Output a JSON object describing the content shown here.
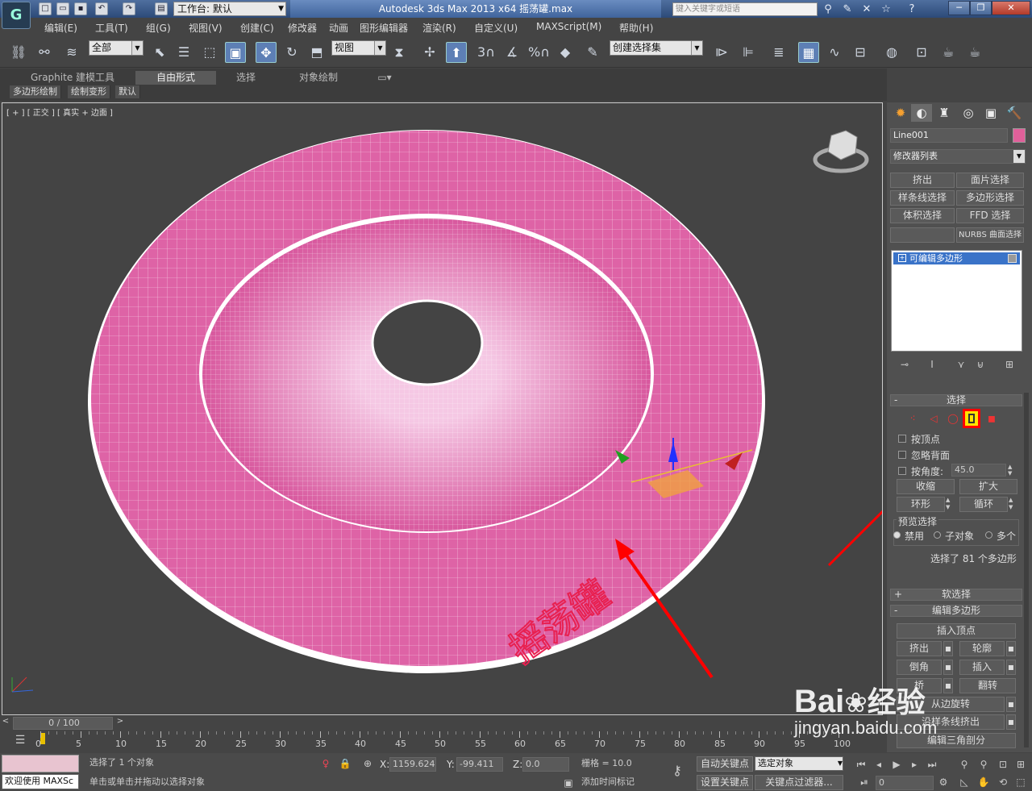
{
  "titlebar": {
    "app_title": "Autodesk 3ds Max  2013 x64      摇荡罐.max",
    "workspace": "工作台: 默认",
    "search_placeholder": "键入关键字或短语"
  },
  "menus": [
    "编辑(E)",
    "工具(T)",
    "组(G)",
    "视图(V)",
    "创建(C)",
    "修改器",
    "动画",
    "图形编辑器",
    "渲染(R)",
    "自定义(U)",
    "MAXScript(M)",
    "帮助(H)"
  ],
  "toolbar": {
    "filter_combo": "全部",
    "ref_coord_combo": "视图",
    "named_selection": "创建选择集",
    "snap_3": "3",
    "snap_pct": "%"
  },
  "ribbon": {
    "tabs": [
      "Graphite 建模工具",
      "自由形式",
      "选择",
      "对象绘制"
    ],
    "subtabs": [
      "多边形绘制",
      "绘制变形",
      "默认"
    ]
  },
  "viewport": {
    "label": "[ + ] [ 正交 ] [ 真实 + 边面 ]",
    "mesh_color": "#e06aa6",
    "text_on_mesh": "摇荡罐"
  },
  "command_panel": {
    "object_name": "Line001",
    "object_color": "#e0609a",
    "modifier_list": "修改器列表",
    "modifier_buttons": [
      "挤出",
      "面片选择",
      "样条线选择",
      "多边形选择",
      "体积选择",
      "FFD 选择",
      "",
      "NURBS 曲面选择"
    ],
    "stack_item": "可编辑多边形",
    "selection_rollout": {
      "title": "选择",
      "by_vertex": "按顶点",
      "ignore_backface": "忽略背面",
      "by_angle": "按角度:",
      "angle_value": "45.0",
      "shrink": "收缩",
      "grow": "扩大",
      "ring": "环形",
      "loop": "循环",
      "preview_label": "预览选择",
      "preview_options": [
        "禁用",
        "子对象",
        "多个"
      ],
      "status": "选择了 81 个多边形"
    },
    "soft_selection": "软选择",
    "edit_poly": {
      "title": "编辑多边形",
      "insert_vertex": "插入顶点",
      "extrude": "挤出",
      "outline": "轮廓",
      "bevel": "倒角",
      "inset": "插入",
      "bridge": "桥",
      "flip": "翻转",
      "hinge": "从边旋转",
      "extrude_along": "沿样条线挤出",
      "edit_tri": "编辑三角剖分"
    }
  },
  "timeline": {
    "frame": "0 / 100",
    "ticks": [
      "0",
      "5",
      "10",
      "15",
      "20",
      "25",
      "30",
      "35",
      "40",
      "45",
      "50",
      "55",
      "60",
      "65",
      "70",
      "75",
      "80",
      "85",
      "90",
      "95",
      "100"
    ]
  },
  "statusbar": {
    "welcome": "欢迎使用 MAXSc",
    "selected": "选择了 1 个对象",
    "hint": "单击或单击并拖动以选择对象",
    "x_label": "X:",
    "x": "1159.624",
    "y_label": "Y:",
    "y": "-99.411",
    "z_label": "Z:",
    "z": "0.0",
    "grid": "栅格 = 10.0",
    "add_time_tag": "添加时间标记",
    "auto_key": "自动关键点",
    "set_key": "设置关键点",
    "selected_objects": "选定对象",
    "key_filters": "关键点过滤器...",
    "frame_field": "0"
  },
  "watermark": {
    "brand": "Bai",
    "brand_cn": "经验",
    "url": "jingyan.baidu.com"
  }
}
